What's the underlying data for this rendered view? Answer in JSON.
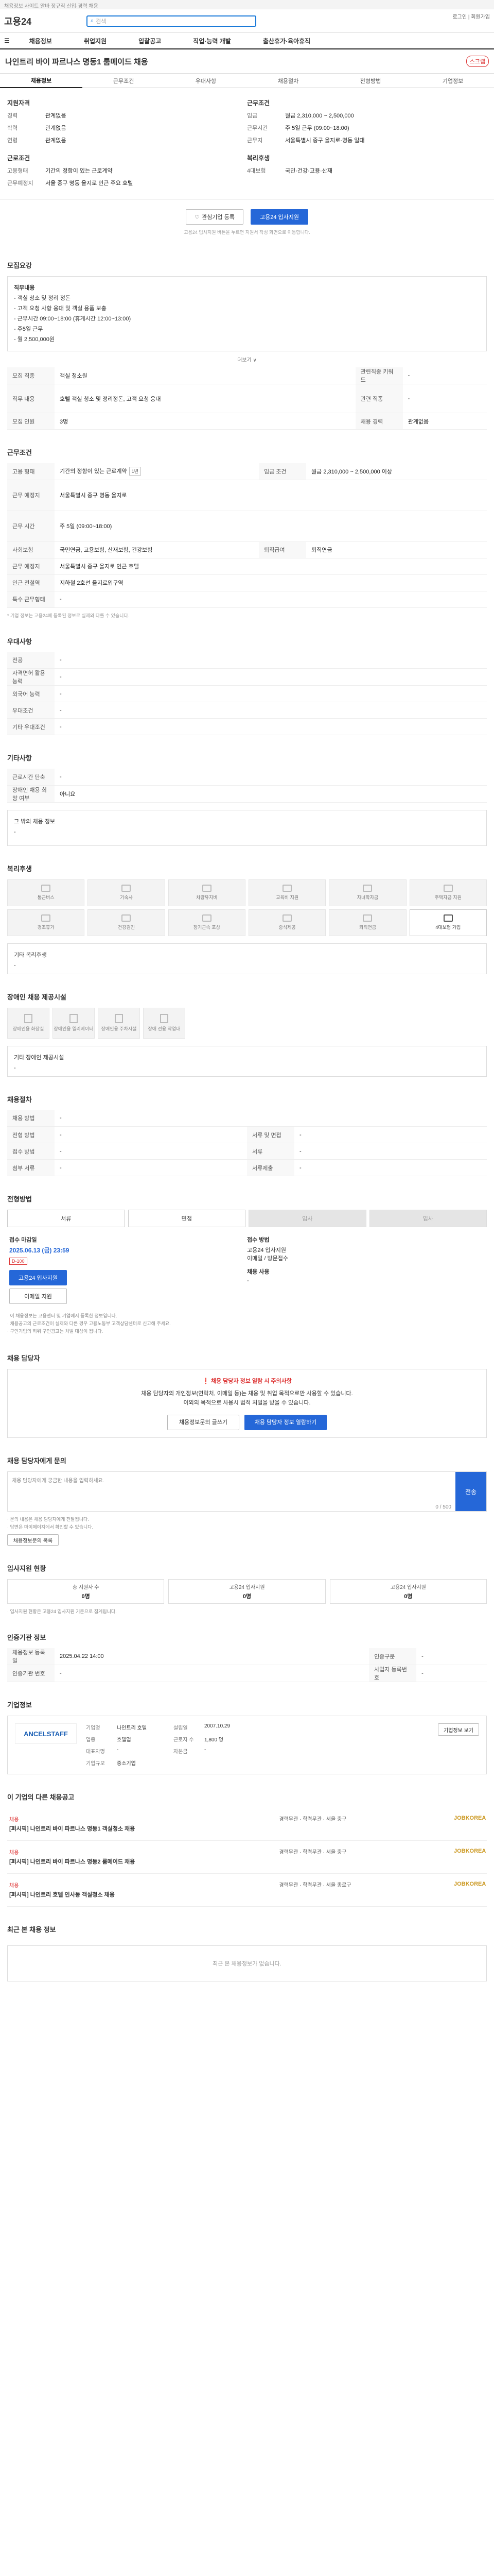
{
  "topbar": {
    "text": "채용정보 사이트 알바 정규직 신입·경력 채용"
  },
  "header": {
    "logo": "고용24",
    "search_placeholder": "검색",
    "right_links": "로그인 | 회원가입"
  },
  "gnb": {
    "items": [
      "채용정보",
      "취업지원",
      "입찰공고",
      "직업·능력 개발",
      "출산휴가·육아휴직"
    ]
  },
  "job": {
    "title": "나인트리 바이 파르나스 명동1 룸메이드 채용",
    "scrap": "스크랩"
  },
  "tabs": [
    "채용정보",
    "근무조건",
    "우대사항",
    "채용절차",
    "전형방법",
    "기업정보"
  ],
  "summary": {
    "left_heading": "지원자격",
    "left": [
      {
        "k": "경력",
        "v": "관계없음"
      },
      {
        "k": "학력",
        "v": "관계없음"
      },
      {
        "k": "연령",
        "v": "관계없음"
      }
    ],
    "left2_heading": "근로조건",
    "left2": [
      {
        "k": "고용형태",
        "v": "기간의 정함이 있는 근로계약"
      },
      {
        "k": "근무예정지",
        "v": "서울 중구 명동 을지로 인근 주요 호텔"
      }
    ],
    "right_heading": "근무조건",
    "right": [
      {
        "k": "임금",
        "v": "월급 2,310,000 ~ 2,500,000"
      },
      {
        "k": "근무시간",
        "v": "주 5일 근무 (09:00~18:00)"
      },
      {
        "k": "근무지",
        "v": "서울특별시 중구 을지로·명동 일대"
      }
    ],
    "right2_heading": "복리후생",
    "right2": [
      {
        "k": "4대보험",
        "v": "국민·건강·고용·산재"
      }
    ]
  },
  "buttons": {
    "interest": "관심기업 등록",
    "apply": "고용24 입사지원"
  },
  "apply_note": "고용24 입사지원 버튼을 누르면 지원서 작성 화면으로 이동합니다.",
  "detail": {
    "heading": "모집요강",
    "sub": "직무내용",
    "lines": [
      "- 객실 청소 및 정리 정돈",
      "- 고객 요청 사항 응대 및 객실 용품 보충",
      "- 근무시간 09:00~18:00 (휴게시간 12:00~13:00)",
      "- 주5일 근무",
      "- 월 2,500,000원"
    ],
    "more": "더보기 ∨"
  },
  "info_table": [
    {
      "k1": "모집 직종",
      "v1": "객실 청소원",
      "k2": "관련직종 키워드",
      "v2": "-"
    },
    {
      "k1": "직무 내용",
      "v1": "호텔 객실 청소 및 정리정돈, 고객 요청 응대",
      "k2": "관련 직종",
      "v2": "-"
    },
    {
      "k1": "모집 인원",
      "v1": "3명",
      "k2": "채용 경력",
      "v2": "관계없음"
    }
  ],
  "work": {
    "heading": "근무조건",
    "rows": [
      {
        "k1": "고용 형태",
        "v1": "기간의 정함이 있는 근로계약",
        "tag": "1년",
        "k2": "임금 조건",
        "v2": "월급 2,310,000 ~ 2,500,000 이상"
      },
      {
        "k1": "근무 예정지",
        "v1": "서울특별시 중구 명동 을지로",
        "k2": "",
        "v2": ""
      },
      {
        "k1": "근무 시간",
        "v1": "주 5일 (09:00~18:00)",
        "k2": "",
        "v2": ""
      },
      {
        "k1": "사회보험",
        "v1": "국민연금, 고용보험, 산재보험, 건강보험",
        "k2": "퇴직급여",
        "v2": "퇴직연금"
      },
      {
        "k1": "근무 예정지",
        "v1": "서울특별시 중구 을지로 인근 호텔",
        "k2": "",
        "v2": ""
      },
      {
        "k1": "인근 전철역",
        "v1": "지하철 2호선 을지로입구역",
        "k2": "",
        "v2": ""
      },
      {
        "k1": "특수 근무형태",
        "v1": "-",
        "k2": "",
        "v2": ""
      }
    ],
    "note": "* 기업 정보는 고용24에 등록된 정보로 실제와 다를 수 있습니다."
  },
  "prefer": {
    "heading": "우대사항",
    "rows": [
      {
        "k": "전공",
        "v": "-"
      },
      {
        "k": "자격면허 활용 능력",
        "v": "-"
      },
      {
        "k": "외국어 능력",
        "v": "-"
      },
      {
        "k": "우대조건",
        "v": "-"
      },
      {
        "k": "기타 우대조건",
        "v": "-"
      }
    ]
  },
  "etc": {
    "heading": "기타사항",
    "rows": [
      {
        "k": "근로시간 단축",
        "v": "-"
      },
      {
        "k": "장애인 채용 희망 여부",
        "v": "아니요"
      }
    ],
    "sub": "그 밖의 채용 정보",
    "subval": "-"
  },
  "welfare": {
    "heading": "복리후생",
    "items": [
      "통근버스",
      "기숙사",
      "차량유지비",
      "교육비 지원",
      "자녀학자금",
      "주택자금 지원",
      "경조휴가",
      "건강검진",
      "장기근속 포상",
      "중식제공",
      "퇴직연금",
      "4대보험 가입"
    ],
    "active": [
      11
    ],
    "etc_label": "기타 복리후생",
    "etc_value": "-"
  },
  "docs": {
    "heading": "장애인 채용 제공시설",
    "items": [
      "장애인용 화장실",
      "장애인용 엘리베이터",
      "장애인용 주차시설",
      "장애 전용 작업대"
    ],
    "etc_label": "기타 장애인 제공시설",
    "etc_value": "-"
  },
  "process": {
    "heading": "채용절차",
    "rows": [
      {
        "k1": "채용 방법",
        "v1": "-",
        "k2": "",
        "v2": ""
      },
      {
        "k1": "전형 방법",
        "v1": "-",
        "k2": "서류 및 면접",
        "v2": "-"
      },
      {
        "k1": "접수 방법",
        "v1": "-",
        "k2": "서류",
        "v2": "-"
      },
      {
        "k1": "첨부 서류",
        "v1": "-",
        "k2": "서류제출",
        "v2": "-"
      }
    ]
  },
  "apply": {
    "heading": "전형방법",
    "steps": [
      "서류",
      "면접",
      "입사",
      "입사"
    ],
    "deadline_label": "접수 마감일",
    "deadline": "2025.06.13 (금) 23:59",
    "dday": "D-100",
    "apply_btn": "고용24 입사지원",
    "email_btn": "이메일 지원",
    "manager_label": "접수 방법",
    "manager_lines": [
      "고용24 입사지원",
      "이메일 / 방문접수"
    ],
    "contact_label": "채용 사용",
    "contact_value": "-",
    "notes": [
      "· 이 채용정보는 고용센터 및 기업에서 등록한 정보입니다.",
      "· 채용공고의 근로조건이 실제와 다른 경우 고용노동부 고객상담센터로 신고해 주세요.",
      "· 구인기업의 허위 구인광고는 처벌 대상이 됩니다."
    ]
  },
  "alert": {
    "heading": "채용 담당자",
    "warn": "채용 담당자 정보 열람 시 주의사항",
    "lines": [
      "채용 담당자의 개인정보(연락처, 이메일 등)는 채용 및 취업 목적으로만 사용할 수 있습니다.",
      "이외의 목적으로 사용시 법적 처벌을 받을 수 있습니다."
    ],
    "btn1": "채용정보문의 글쓰기",
    "btn2": "채용 담당자 정보 열람하기"
  },
  "qa": {
    "heading": "채용 담당자에게 문의",
    "placeholder": "채용 담당자에게 궁금한 내용을 입력하세요.",
    "btn": "전송",
    "count": "0 / 500",
    "notes": [
      "· 문의 내용은 채용 담당자에게 전달됩니다.",
      "· 답변은 마이페이지에서 확인할 수 있습니다."
    ],
    "link": "채용정보문의 목록"
  },
  "stats": {
    "heading": "입사지원 현황",
    "items": [
      {
        "label": "총 지원자 수",
        "value": "0명"
      },
      {
        "label": "고용24 입사지원",
        "value": "0명"
      },
      {
        "label": "고용24 입사지원",
        "value": "0명"
      }
    ],
    "note": "· 입사지원 현황은 고용24 입사지원 기준으로 집계됩니다."
  },
  "manager": {
    "heading": "인증기관 정보",
    "rows": [
      {
        "k1": "채용정보 등록일",
        "v1": "2025.04.22 14:00",
        "k2": "인증구분",
        "v2": "-"
      },
      {
        "k1": "인증기관 번호",
        "v1": "-",
        "k2": "사업자 등록번호",
        "v2": "-"
      }
    ]
  },
  "company": {
    "heading": "기업정보",
    "logo": "ANCELSTAFF",
    "rows": [
      {
        "k1": "기업명",
        "v1": "나인트리 호텔",
        "k2": "설립일",
        "v2": "2007.10.29"
      },
      {
        "k1": "업종",
        "v1": "호텔업",
        "k2": "근로자 수",
        "v2": "1,800 명"
      },
      {
        "k1": "대표자명",
        "v1": "-",
        "k2": "자본금",
        "v2": "-"
      },
      {
        "k1": "기업규모",
        "v1": "중소기업",
        "k2": "",
        "v2": ""
      }
    ],
    "btn": "기업정보 보기"
  },
  "related": {
    "heading": "이 기업의 다른 채용공고",
    "items": [
      {
        "hot": "채용",
        "title": "[퍼시픽] 나인트리 바이 파르나스 명동1 객실청소 채용",
        "cond": "경력무관 · 학력무관 · 서울 중구",
        "logo": "JOBKOREA"
      },
      {
        "hot": "채용",
        "title": "[퍼시픽] 나인트리 바이 파르나스 명동2 룸메이드 채용",
        "cond": "경력무관 · 학력무관 · 서울 중구",
        "logo": "JOBKOREA"
      },
      {
        "hot": "채용",
        "title": "[퍼시픽] 나인트리 호텔 인사동 객실청소 채용",
        "cond": "경력무관 · 학력무관 · 서울 종로구",
        "logo": "JOBKOREA"
      }
    ]
  },
  "recent": {
    "heading": "최근 본 채용 정보",
    "empty": "최근 본 채용정보가 없습니다."
  }
}
